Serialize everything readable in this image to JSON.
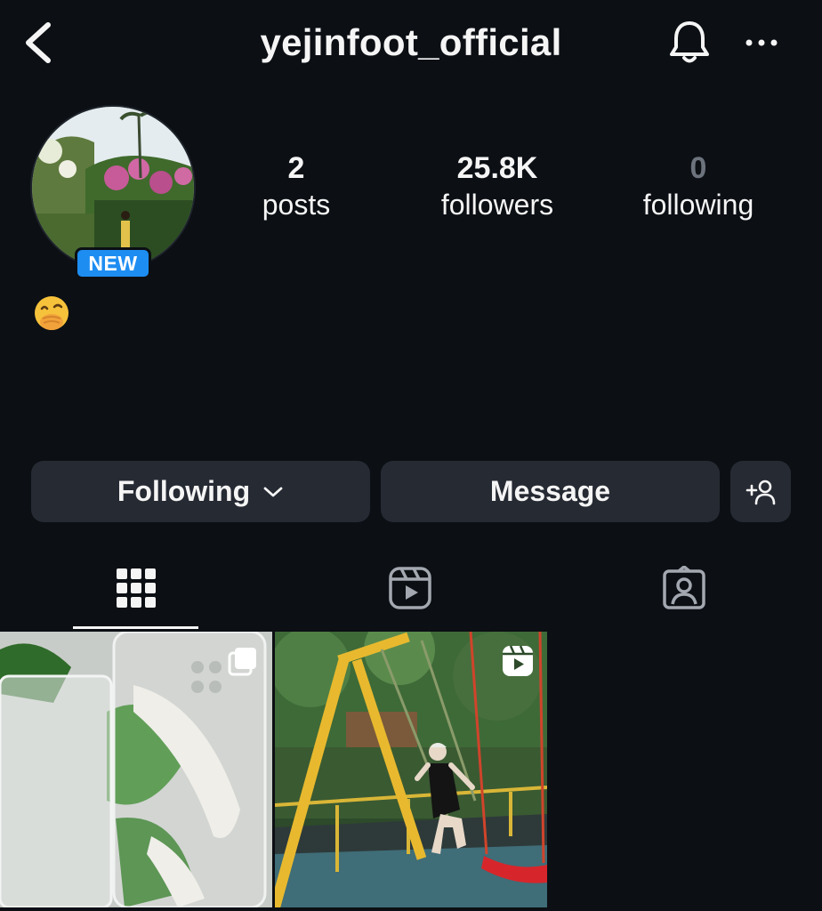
{
  "header": {
    "username": "yejinfoot_official",
    "back_icon": "chevron-left-icon",
    "notification_icon": "bell-icon",
    "more_icon": "more-horizontal-icon"
  },
  "profile": {
    "avatar_badge": "NEW",
    "bio_emoji": "🤭",
    "stats": [
      {
        "value": "2",
        "label": "posts"
      },
      {
        "value": "25.8K",
        "label": "followers"
      },
      {
        "value": "0",
        "label": "following"
      }
    ]
  },
  "actions": {
    "following_label": "Following",
    "message_label": "Message",
    "add_user_icon": "add-user-icon"
  },
  "tabs": [
    {
      "name": "grid",
      "icon": "grid-icon",
      "active": true
    },
    {
      "name": "reels",
      "icon": "reels-icon",
      "active": false
    },
    {
      "name": "tagged",
      "icon": "tagged-icon",
      "active": false
    }
  ],
  "posts": [
    {
      "type": "carousel",
      "overlay_icon": "carousel-icon"
    },
    {
      "type": "reel",
      "overlay_icon": "reels-icon"
    }
  ],
  "colors": {
    "background": "#0c0f14",
    "button": "#262a33",
    "badge": "#1d8df2",
    "text": "#f5f5f5",
    "muted": "#6c737d"
  }
}
